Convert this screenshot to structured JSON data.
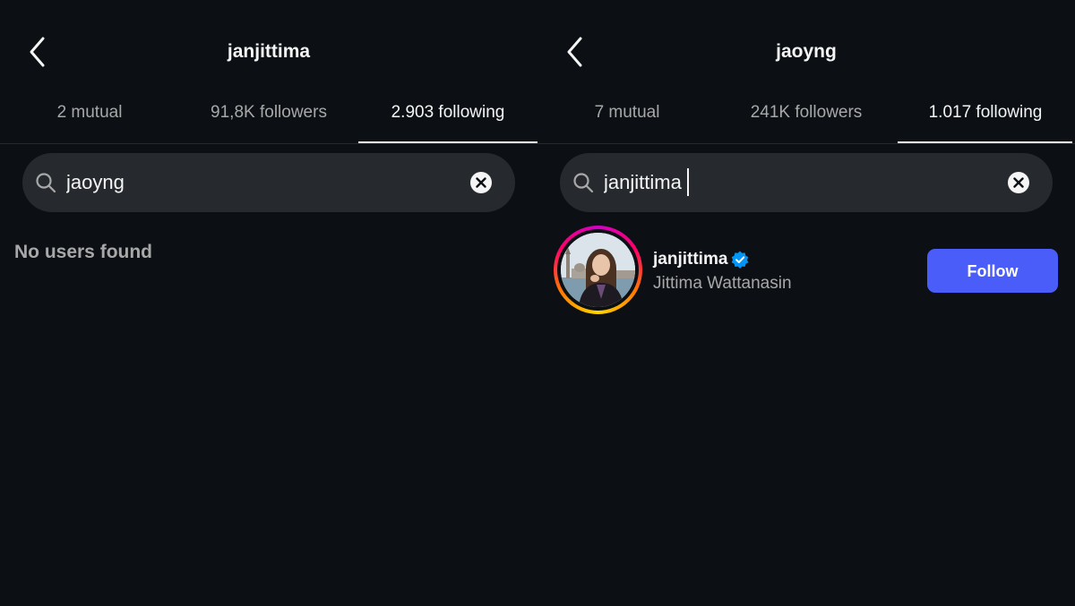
{
  "left_panel": {
    "title": "janjittima",
    "tabs": [
      {
        "label": "2 mutual"
      },
      {
        "label": "91,8K followers"
      },
      {
        "label": "2.903 following"
      }
    ],
    "active_tab": 2,
    "search": {
      "value": "jaoyng"
    },
    "empty_message": "No users found"
  },
  "right_panel": {
    "title": "jaoyng",
    "tabs": [
      {
        "label": "7 mutual"
      },
      {
        "label": "241K followers"
      },
      {
        "label": "1.017 following"
      }
    ],
    "active_tab": 2,
    "search": {
      "value": "janjittima"
    },
    "results": [
      {
        "username": "janjittima",
        "full_name": "Jittima Wattanasin",
        "verified": true,
        "has_story_ring": true,
        "button_label": "Follow"
      }
    ]
  },
  "icons": {
    "back": "chevron-left-icon",
    "search": "search-icon",
    "clear": "clear-circle-x-icon",
    "verified": "verified-badge-icon"
  },
  "colors": {
    "background": "#0c1014",
    "primary_text": "#f5f5f5",
    "secondary_text": "#a8a8a8",
    "search_bg": "#262a2f",
    "follow_button": "#4a5df9",
    "verified_blue": "#0095f6"
  }
}
